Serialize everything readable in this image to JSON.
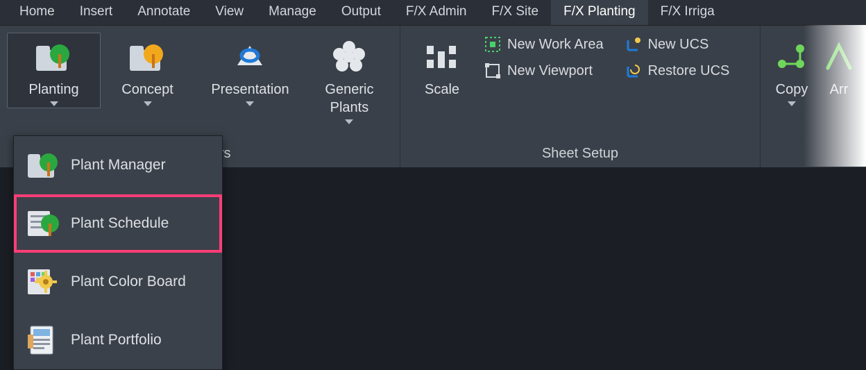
{
  "tabs": [
    "Home",
    "Insert",
    "Annotate",
    "View",
    "Manage",
    "Output",
    "F/X Admin",
    "F/X Site",
    "F/X Planting",
    "F/X Irriga"
  ],
  "active_tab_index": 8,
  "panel1": {
    "title": "Managers",
    "planting": "Planting",
    "concept": "Concept",
    "presentation": "Presentation",
    "generic": "Generic Plants"
  },
  "panel2": {
    "title": "Sheet Setup",
    "scale": "Scale",
    "newworkarea": "New Work Area",
    "newviewport": "New Viewport",
    "newucs": "New UCS",
    "restoreucs": "Restore UCS"
  },
  "panel3": {
    "copy": "Copy",
    "arr": "Arr"
  },
  "dropdown": {
    "plant_manager": "Plant Manager",
    "plant_schedule": "Plant Schedule",
    "plant_colorboard": "Plant Color Board",
    "plant_portfolio": "Plant Portfolio"
  }
}
